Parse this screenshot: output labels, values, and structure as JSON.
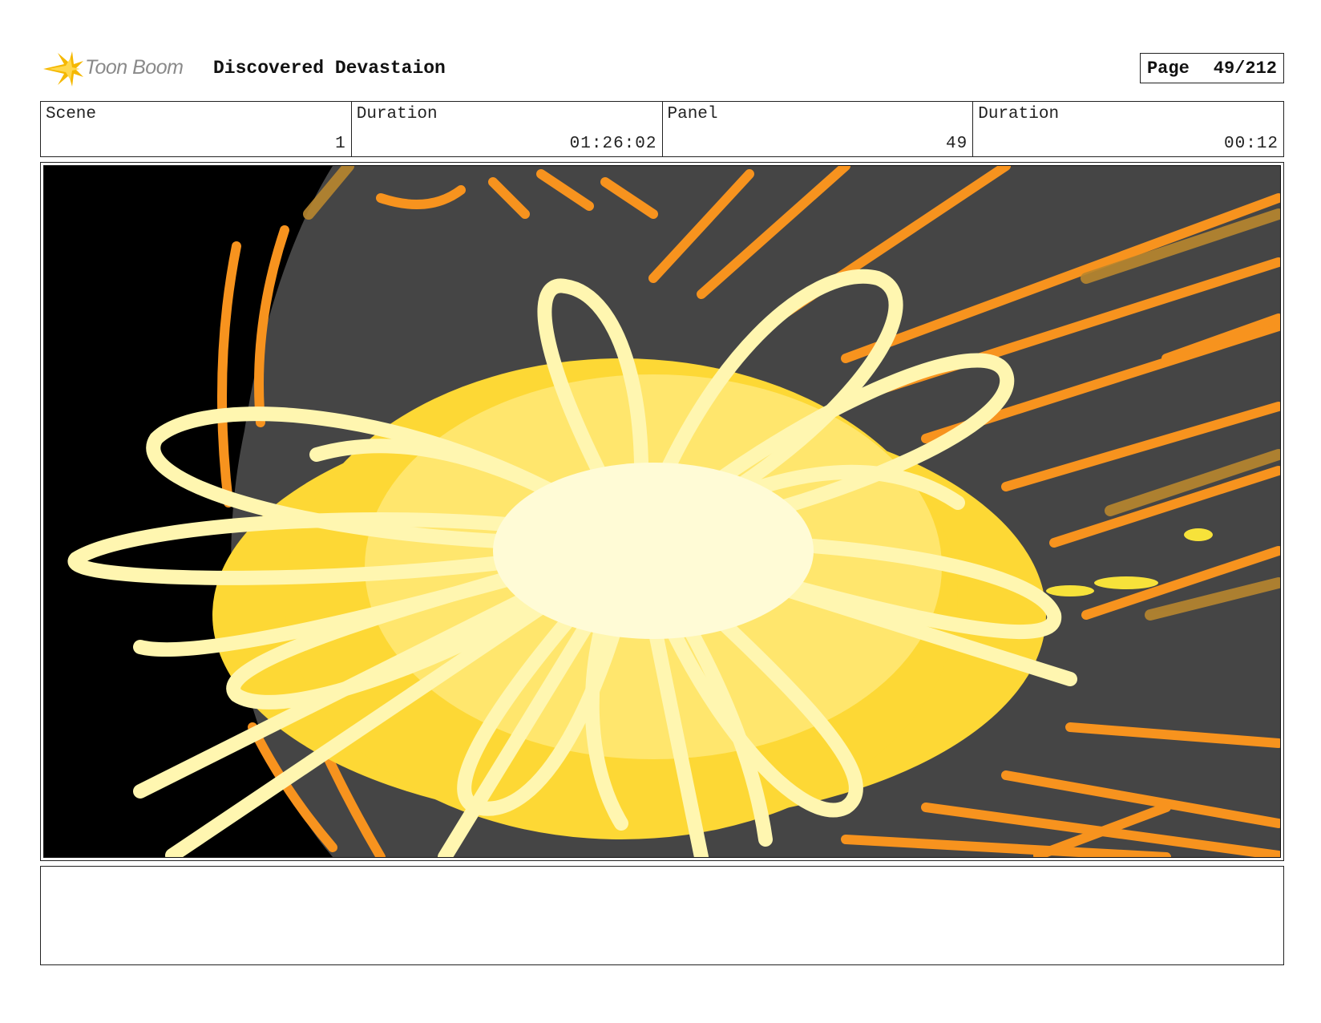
{
  "header": {
    "logo_text": "Toon Boom",
    "title": "Discovered Devastaion",
    "page_label": "Page",
    "page_value": "49/212"
  },
  "info": {
    "scene_label": "Scene",
    "scene_value": "1",
    "duration_label": "Duration",
    "duration_value": "01:26:02",
    "panel_label": "Panel",
    "panel_value": "49",
    "panel_duration_label": "Duration",
    "panel_duration_value": "00:12"
  },
  "colors": {
    "logo_yellow": "#f5b800",
    "background_black": "#000000",
    "planet_gray": "#454545",
    "streak_orange": "#f7931e",
    "burst_yellow": "#fdd835",
    "burst_pale": "#fff6b0"
  },
  "notes": {
    "text": ""
  }
}
